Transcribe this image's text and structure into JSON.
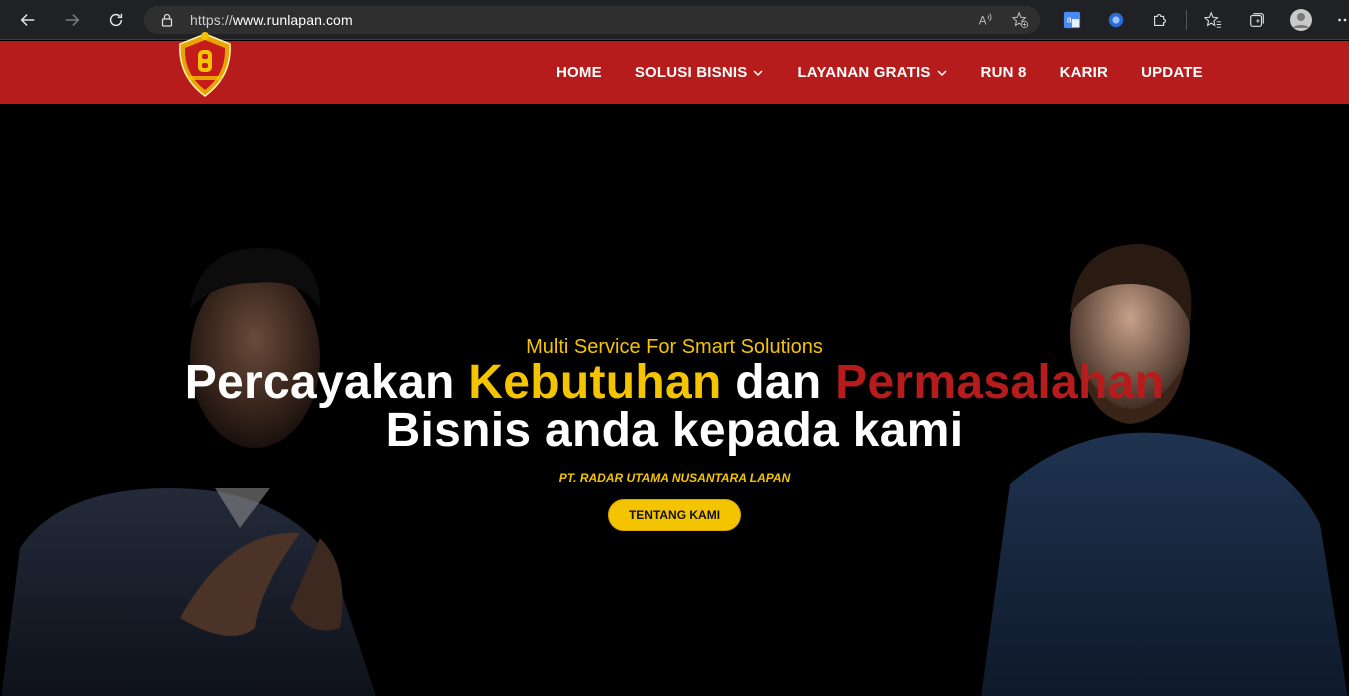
{
  "browser": {
    "url_prefix": "https://",
    "url_host": "www.runlapan.com"
  },
  "nav": {
    "items": [
      {
        "label": "HOME",
        "dropdown": false
      },
      {
        "label": "SOLUSI BISNIS",
        "dropdown": true
      },
      {
        "label": "LAYANAN GRATIS",
        "dropdown": true
      },
      {
        "label": "RUN 8",
        "dropdown": false
      },
      {
        "label": "KARIR",
        "dropdown": false
      },
      {
        "label": "UPDATE",
        "dropdown": false
      }
    ]
  },
  "hero": {
    "tagline": "Multi Service For Smart Solutions",
    "headline_part1": "Percayakan ",
    "headline_yellow": "Kebutuhan",
    "headline_part2": " dan ",
    "headline_red": "Permasalahan",
    "headline_line2": "Bisnis anda kepada kami",
    "company": "PT. RADAR UTAMA NUSANTARA LAPAN",
    "cta_label": "TENTANG KAMI"
  },
  "colors": {
    "header_red": "#b71c1c",
    "accent_yellow": "#f5c400",
    "hero_bg": "#000000"
  }
}
